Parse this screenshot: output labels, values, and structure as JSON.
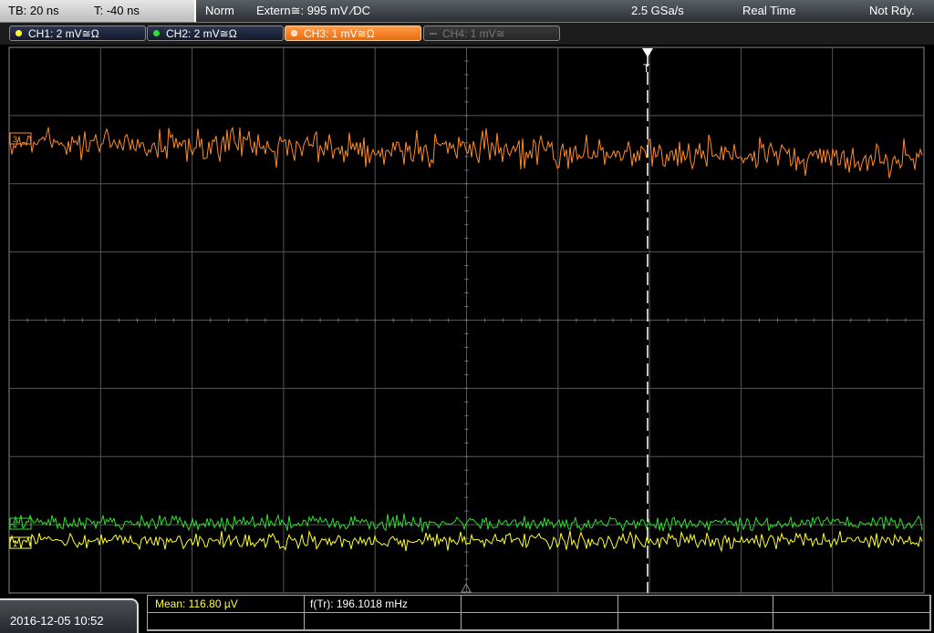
{
  "topbar": {
    "timebase": "TB: 20 ns",
    "trigger_offset": "T: -40 ns",
    "trigger_mode": "Norm",
    "trigger_source": "Extern≅: 995 mV ⁄DC",
    "sample_rate": "2.5 GSa/s",
    "acquisition_mode": "Real Time",
    "status": "Not Rdy."
  },
  "channels": [
    {
      "label": "CH1: 2 mV≅Ω",
      "color": "#ffff33",
      "active": true
    },
    {
      "label": "CH2: 2 mV≅Ω",
      "color": "#33dd33",
      "active": true
    },
    {
      "label": "CH3: 1 mV≅Ω",
      "color": "#ff8c2a",
      "active": true,
      "selected": true
    },
    {
      "label": "CH4: 1 mV≅",
      "color": "#777777",
      "active": false
    }
  ],
  "display": {
    "trigger_marker_label": "T",
    "grid_color": "#555555",
    "trace_colors": {
      "ch1": "#ffff33",
      "ch2": "#33dd33",
      "ch3": "#ff8c2a"
    }
  },
  "measurements": {
    "mean": "Mean: 116.80 µV",
    "freq": "f(Tr): 196.1018 mHz"
  },
  "timestamp": "2016-12-05 10:52"
}
